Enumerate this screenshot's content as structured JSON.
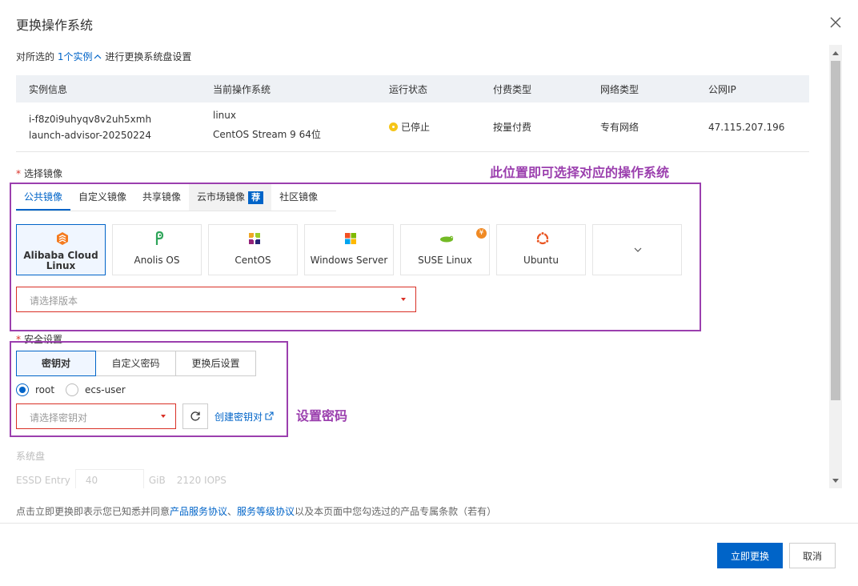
{
  "dialog": {
    "title": "更换操作系统"
  },
  "selection": {
    "prefix": "对所选的",
    "link": "1个实例",
    "suffix": "进行更换系统盘设置"
  },
  "instance_table": {
    "headers": [
      "实例信息",
      "当前操作系统",
      "运行状态",
      "付费类型",
      "网络类型",
      "公网IP"
    ],
    "row": {
      "instance_id": "i-f8z0i9uhyqv8v2uh5xmh",
      "instance_name": "launch-advisor-20250224",
      "os_family": "linux",
      "os_version": "CentOS Stream 9 64位",
      "status": "已停止",
      "billing": "按量付费",
      "network": "专有网络",
      "public_ip": "47.115.207.196"
    }
  },
  "image": {
    "label": "选择镜像",
    "required_mark": "*",
    "annotation": "此位置即可选择对应的操作系统",
    "tabs": [
      {
        "label": "公共镜像",
        "active": true
      },
      {
        "label": "自定义镜像"
      },
      {
        "label": "共享镜像"
      },
      {
        "label": "云市场镜像",
        "badge": "荐"
      },
      {
        "label": "社区镜像"
      }
    ],
    "os_options": [
      {
        "name": "Alibaba Cloud Linux",
        "icon": "alibaba-cloud-icon",
        "active": true
      },
      {
        "name": "Anolis OS",
        "icon": "anolis-icon"
      },
      {
        "name": "CentOS",
        "icon": "centos-icon"
      },
      {
        "name": "Windows Server",
        "icon": "windows-icon"
      },
      {
        "name": "SUSE Linux",
        "icon": "suse-icon",
        "badge": "¥"
      },
      {
        "name": "Ubuntu",
        "icon": "ubuntu-icon"
      }
    ],
    "more_icon": "chevron-down-icon",
    "version_placeholder": "请选择版本"
  },
  "security": {
    "label": "安全设置",
    "required_mark": "*",
    "annotation": "设置密码",
    "segments": [
      {
        "label": "密钥对",
        "active": true
      },
      {
        "label": "自定义密码"
      },
      {
        "label": "更换后设置"
      }
    ],
    "users": [
      {
        "label": "root",
        "checked": true
      },
      {
        "label": "ecs-user"
      }
    ],
    "keypair_placeholder": "请选择密钥对",
    "create_link": "创建密钥对"
  },
  "system_disk": {
    "label": "系统盘",
    "type": "ESSD Entry",
    "size": "40",
    "unit": "GiB",
    "iops": "2120 IOPS"
  },
  "footer": {
    "agree_prefix": "点击立即更换即表示您已知悉并同意",
    "link1": "产品服务协议",
    "sep": "、",
    "link2": "服务等级协议",
    "agree_suffix": "以及本页面中您勾选过的产品专属条款（若有）",
    "confirm": "立即更换",
    "cancel": "取消"
  },
  "colors": {
    "primary": "#0064c8",
    "annotation": "#9b3fae",
    "error": "#d93026",
    "stopped": "#f5c518"
  }
}
